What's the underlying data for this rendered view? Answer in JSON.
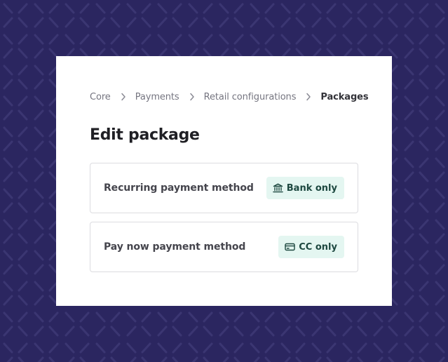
{
  "colors": {
    "background": "#2b2660",
    "pattern": "#3b3672",
    "card": "#ffffff",
    "badge_bg": "#e4f6f1",
    "badge_text": "#1d4840",
    "row_border": "#dcdce0"
  },
  "breadcrumb": {
    "items": [
      {
        "label": "Core"
      },
      {
        "label": "Payments"
      },
      {
        "label": "Retail configurations"
      },
      {
        "label": "Packages"
      }
    ],
    "separator_icon": "chevron-right-icon"
  },
  "page": {
    "title": "Edit package"
  },
  "settings": [
    {
      "label": "Recurring payment method",
      "badge": {
        "label": "Bank only",
        "icon": "bank-icon"
      }
    },
    {
      "label": "Pay now payment method",
      "badge": {
        "label": "CC only",
        "icon": "credit-card-icon"
      }
    }
  ]
}
